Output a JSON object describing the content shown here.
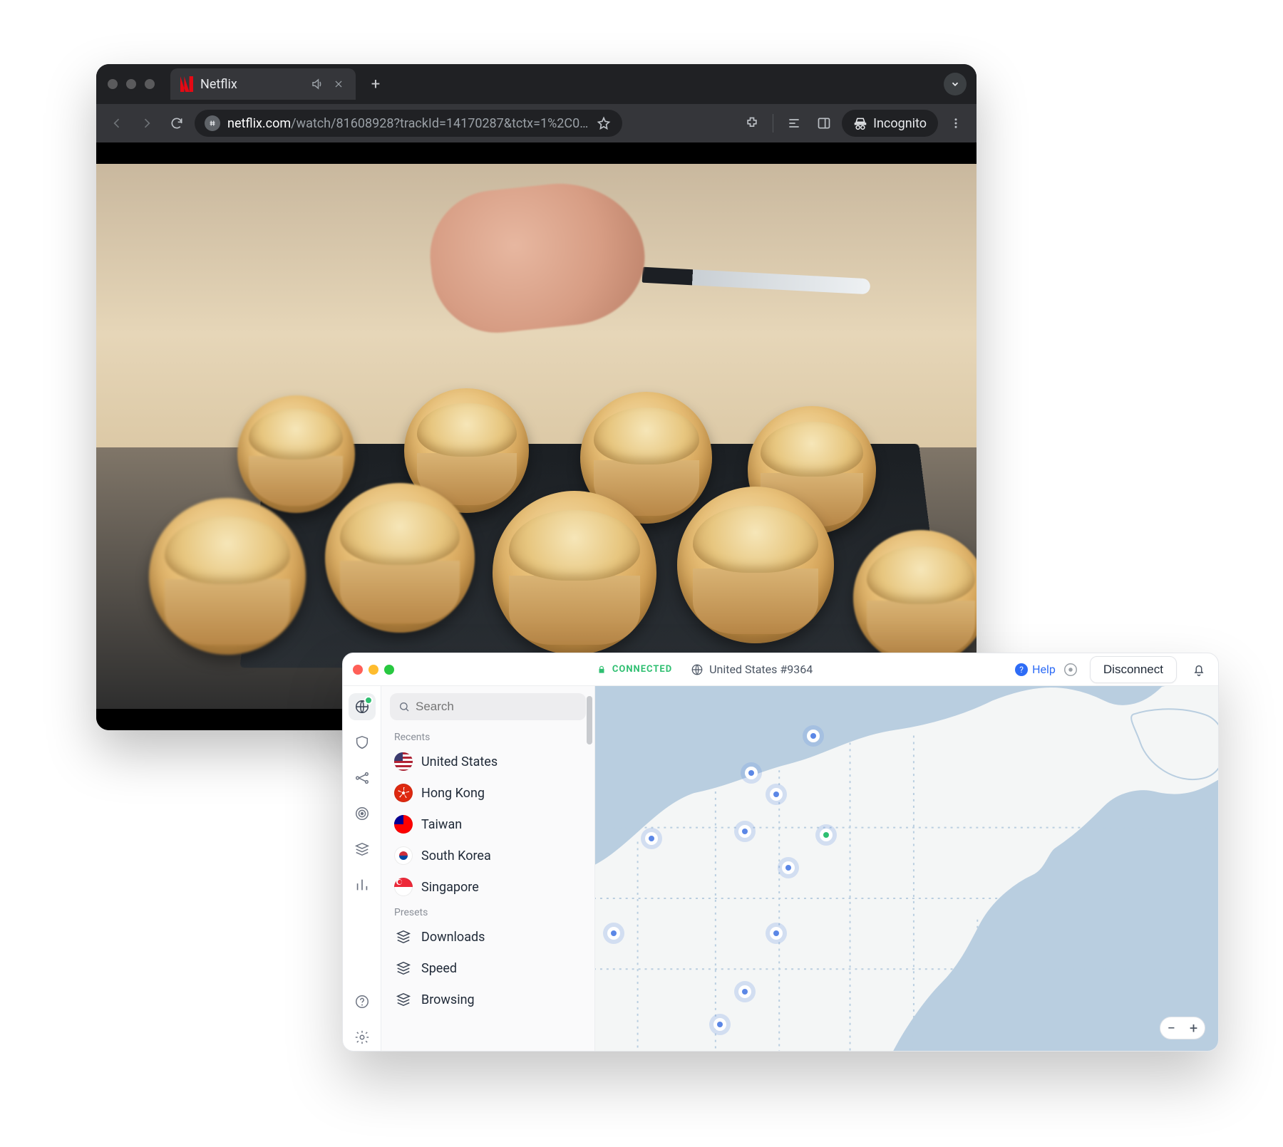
{
  "browser": {
    "tab_title": "Netflix",
    "url_host": "netflix.com",
    "url_rest": "/watch/81608928?trackId=14170287&tctx=1%2C0…",
    "incognito_label": "Incognito"
  },
  "vpn": {
    "status_label": "CONNECTED",
    "server_label": "United States #9364",
    "help_label": "Help",
    "disconnect_label": "Disconnect",
    "search_placeholder": "Search",
    "sections": {
      "recents": "Recents",
      "presets": "Presets"
    },
    "recents": [
      {
        "label": "United States",
        "flag": "flag-us"
      },
      {
        "label": "Hong Kong",
        "flag": "flag-hk"
      },
      {
        "label": "Taiwan",
        "flag": "flag-tw"
      },
      {
        "label": "South Korea",
        "flag": "flag-kr"
      },
      {
        "label": "Singapore",
        "flag": "flag-sg"
      }
    ],
    "presets": [
      {
        "label": "Downloads"
      },
      {
        "label": "Speed"
      },
      {
        "label": "Browsing"
      }
    ],
    "zoom": {
      "minus": "−",
      "plus": "+"
    }
  }
}
